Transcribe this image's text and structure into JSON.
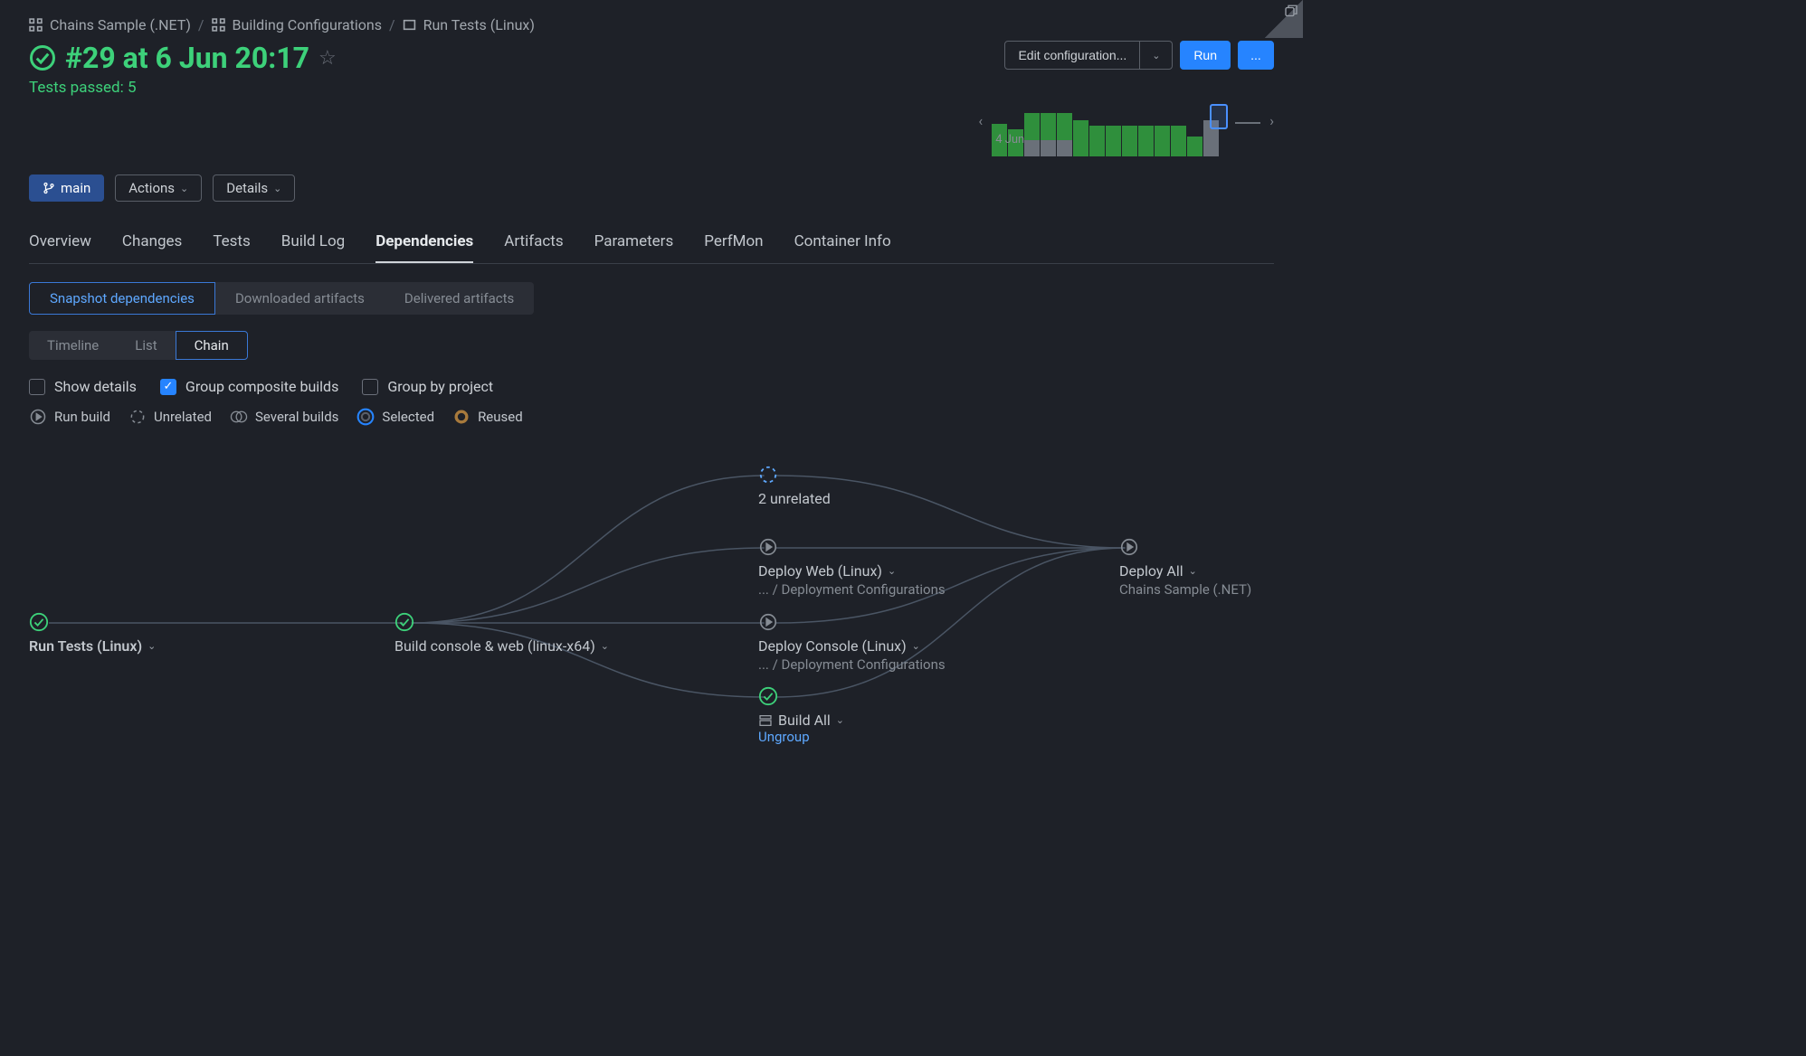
{
  "breadcrumbs": {
    "items": [
      {
        "label": "Chains Sample (.NET)",
        "icon": "grid"
      },
      {
        "label": "Building Configurations",
        "icon": "grid"
      },
      {
        "label": "Run Tests (Linux)",
        "icon": "square"
      }
    ]
  },
  "topActions": {
    "edit": "Edit configuration...",
    "run": "Run",
    "more": "..."
  },
  "build": {
    "title": "#29 at 6 Jun 20:17",
    "testsLine": "Tests passed: 5"
  },
  "chart_data": {
    "type": "bar",
    "label": "4 Jun",
    "series": [
      {
        "name": "green",
        "values": [
          36,
          30,
          30,
          30,
          30,
          40,
          34,
          34,
          34,
          34,
          34,
          34,
          22,
          0,
          0
        ]
      },
      {
        "name": "grey",
        "values": [
          0,
          0,
          18,
          18,
          18,
          0,
          0,
          0,
          0,
          0,
          0,
          0,
          0,
          40,
          0
        ]
      }
    ],
    "highlight_index": 12,
    "tail_line": true
  },
  "pills": {
    "branch": "main",
    "actions": "Actions",
    "details": "Details"
  },
  "tabs": {
    "items": [
      "Overview",
      "Changes",
      "Tests",
      "Build Log",
      "Dependencies",
      "Artifacts",
      "Parameters",
      "PerfMon",
      "Container Info"
    ],
    "active_index": 4
  },
  "subtabs": {
    "items": [
      "Snapshot dependencies",
      "Downloaded artifacts",
      "Delivered artifacts"
    ],
    "active_index": 0
  },
  "viewtabs": {
    "items": [
      "Timeline",
      "List",
      "Chain"
    ],
    "active_index": 2
  },
  "checkboxes": {
    "showDetails": {
      "label": "Show details",
      "checked": false
    },
    "groupComposite": {
      "label": "Group composite builds",
      "checked": true
    },
    "groupByProject": {
      "label": "Group by project",
      "checked": false
    }
  },
  "legend": {
    "items": [
      {
        "icon": "play",
        "label": "Run build"
      },
      {
        "icon": "dashed",
        "label": "Unrelated"
      },
      {
        "icon": "double",
        "label": "Several builds"
      },
      {
        "icon": "ring-blue",
        "label": "Selected"
      },
      {
        "icon": "ring-brown",
        "label": "Reused"
      }
    ]
  },
  "chain": {
    "nodes": {
      "runTests": {
        "title": "Run Tests (Linux)"
      },
      "buildConsole": {
        "title": "Build console & web (linux-x64)"
      },
      "unrelated": {
        "title": "2 unrelated"
      },
      "deployWeb": {
        "title": "Deploy Web (Linux)",
        "sub": "... / Deployment Configurations"
      },
      "deployConsole": {
        "title": "Deploy Console (Linux)",
        "sub": "... / Deployment Configurations"
      },
      "buildAll": {
        "title": "Build All",
        "link": "Ungroup"
      },
      "deployAll": {
        "title": "Deploy All",
        "sub": "Chains Sample (.NET)"
      }
    }
  }
}
